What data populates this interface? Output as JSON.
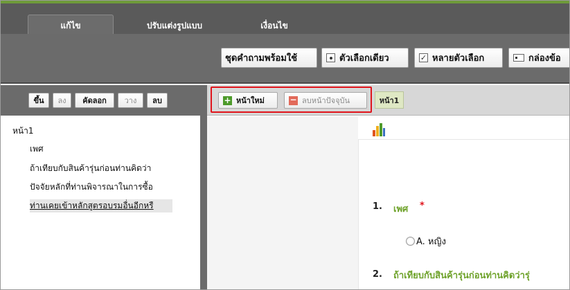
{
  "tabs": {
    "edit": "แก้ไข",
    "format": "ปรับแต่งรูปแบบ",
    "conditions": "เงื่อนไข"
  },
  "ribbon": {
    "ready_questions": "ชุดคำถามพร้อมใช้",
    "single_choice": "ตัวเลือกเดียว",
    "multi_choice": "หลายตัวเลือก",
    "textbox": "กล่องข้อ"
  },
  "left_toolbar": {
    "up": "ขึ้น",
    "down": "ลง",
    "copy": "คัดลอก",
    "paste": "วาง",
    "delete": "ลบ"
  },
  "tree": {
    "page": "หน้า1",
    "items": [
      "เพศ",
      "ถ้าเทียบกับสินค้ารุ่นก่อนท่านคิดว่า",
      "ปัจจัยหลักที่ท่านพิจารณาในการซื้อ",
      "ท่านเคยเข้าหลักสูตรอบรมอื่นอีกหรื"
    ]
  },
  "page_toolbar": {
    "new_page": "หน้าใหม่",
    "delete_page": "ลบหน้าปัจจุบัน",
    "page_tab": "หน้า1"
  },
  "survey": {
    "q1": {
      "num": "1.",
      "title": "เพศ",
      "required": "*",
      "option": "A. หญิง"
    },
    "q2": {
      "num": "2.",
      "title": "ถ้าเทียบกับสินค้ารุ่นก่อนท่านคิดว่ารุ่"
    }
  },
  "colors": {
    "accent_green": "#6ea22a",
    "highlight_red": "#e0141c",
    "ribbon_gray": "#6b6b6b"
  }
}
